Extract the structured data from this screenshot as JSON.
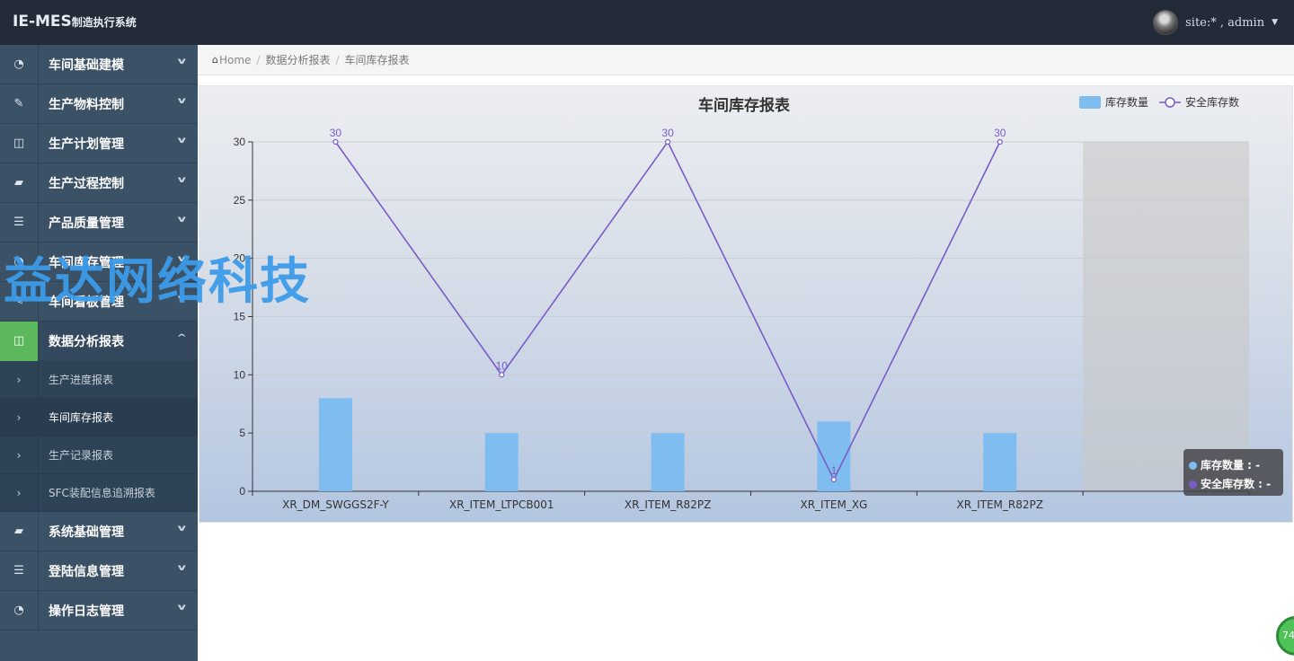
{
  "app": {
    "title_main": "IE-MES",
    "title_sub": "制造执行系统"
  },
  "user": {
    "label": "site:* , admin"
  },
  "sidebar": {
    "items": [
      {
        "label": "车间基础建模",
        "icon": "dashboard-icon"
      },
      {
        "label": "生产物料控制",
        "icon": "edit-icon"
      },
      {
        "label": "生产计划管理",
        "icon": "columns-icon"
      },
      {
        "label": "生产过程控制",
        "icon": "book-icon"
      },
      {
        "label": "产品质量管理",
        "icon": "list-icon"
      },
      {
        "label": "车间库存管理",
        "icon": "dashboard-icon"
      },
      {
        "label": "车间看板管理",
        "icon": "edit-icon"
      },
      {
        "label": "数据分析报表",
        "icon": "columns-icon"
      }
    ],
    "sub_items": [
      {
        "label": "生产进度报表"
      },
      {
        "label": "车间库存报表"
      },
      {
        "label": "生产记录报表"
      },
      {
        "label": "SFC装配信息追溯报表"
      }
    ],
    "items_after": [
      {
        "label": "系统基础管理",
        "icon": "book-icon"
      },
      {
        "label": "登陆信息管理",
        "icon": "list-icon"
      },
      {
        "label": "操作日志管理",
        "icon": "dashboard-icon"
      }
    ]
  },
  "breadcrumb": {
    "home": "Home",
    "level1": "数据分析报表",
    "level2": "车间库存报表"
  },
  "watermark": "益达网络科技",
  "tooltip": {
    "row1": "库存数量 : -",
    "row2": "安全库存数 : -"
  },
  "badge": {
    "text": "74"
  },
  "colors": {
    "bar": "#7fbdf0",
    "line": "#7a5bc7",
    "highlight": "#c8c8c8"
  },
  "chart_data": {
    "type": "bar",
    "title": "车间库存报表",
    "categories": [
      "XR_DM_SWGGS2F-Y",
      "XR_ITEM_LTPCB001",
      "XR_ITEM_R82PZ",
      "XR_ITEM_XG",
      "XR_ITEM_R82PZ",
      ""
    ],
    "series": [
      {
        "name": "库存数量",
        "type": "bar",
        "values": [
          8,
          5,
          5,
          6,
          5,
          null
        ]
      },
      {
        "name": "安全库存数",
        "type": "line",
        "values": [
          30,
          10,
          30,
          1,
          30,
          null
        ],
        "labels": [
          "30",
          "10",
          "30",
          "1",
          "30",
          ""
        ]
      }
    ],
    "ylim": [
      0,
      30
    ],
    "yticks": [
      0,
      5,
      10,
      15,
      20,
      25,
      30
    ],
    "grid": true,
    "legend": "top-right",
    "highlighted_category": 5
  }
}
